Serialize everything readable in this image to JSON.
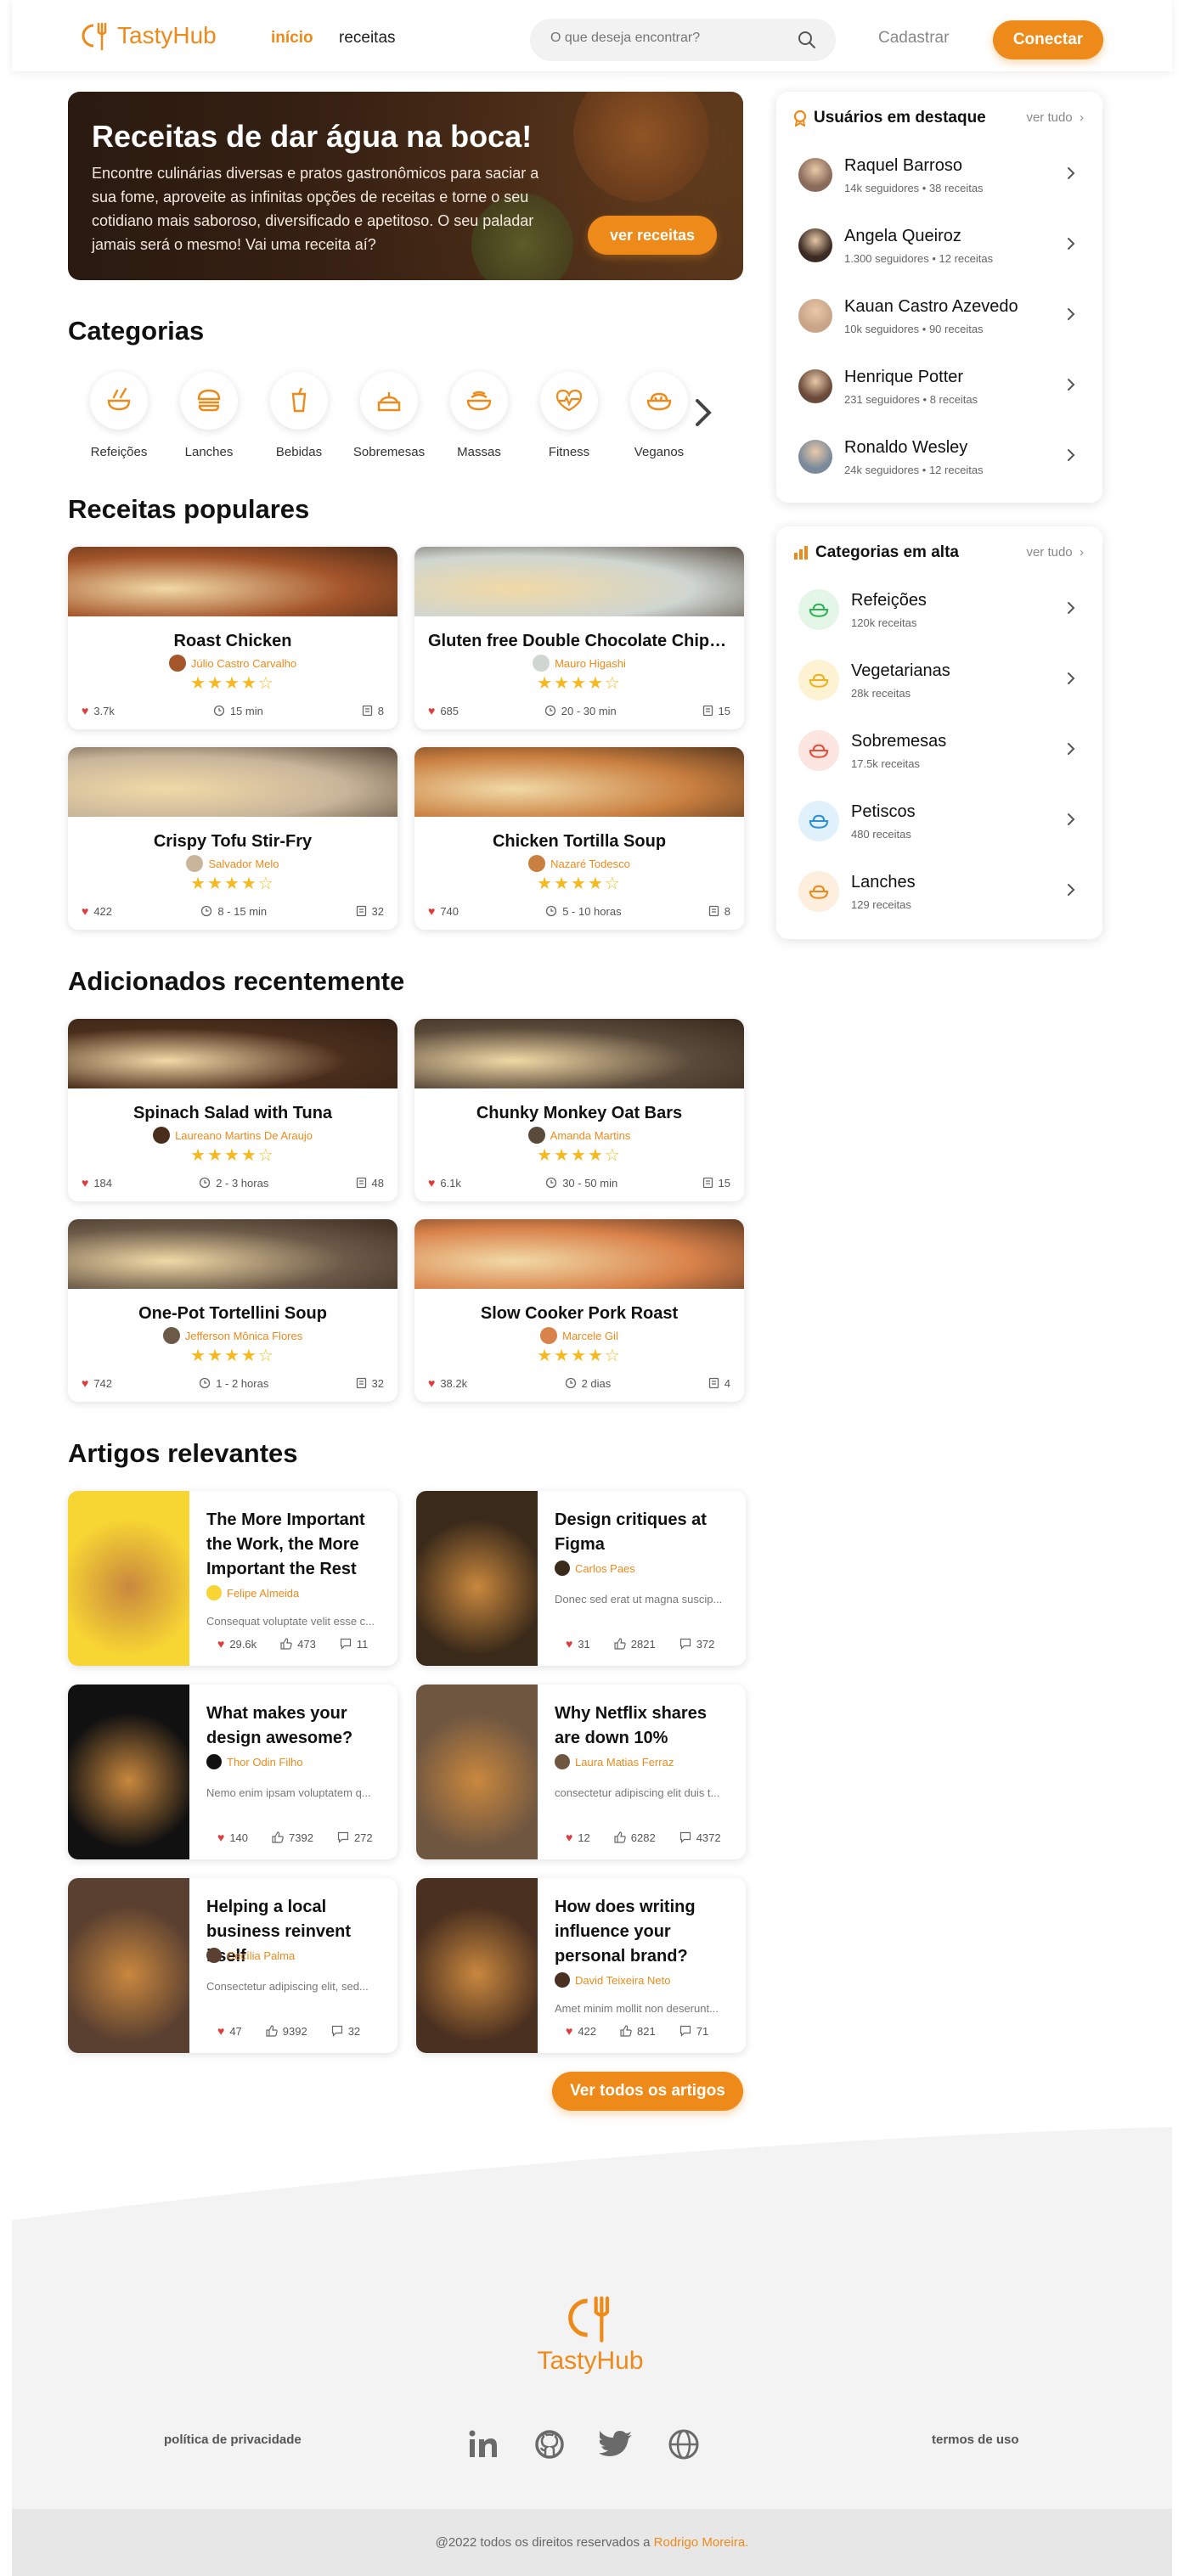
{
  "header": {
    "brand": "TastyHub",
    "nav": [
      "início",
      "receitas"
    ],
    "search_placeholder": "O que deseja encontrar?",
    "signup": "Cadastrar",
    "login": "Conectar"
  },
  "hero": {
    "title": "Receitas de dar água na boca!",
    "text": "Encontre culinárias diversas e pratos gastronômicos para saciar a sua fome, aproveite as infinitas opções de receitas e torne o seu cotidiano mais saboroso, diversificado e apetitoso. O seu paladar jamais será o mesmo! Vai uma receita aí?",
    "button": "ver receitas"
  },
  "categories": {
    "title": "Categorias",
    "items": [
      "Refeições",
      "Lanches",
      "Bebidas",
      "Sobremesas",
      "Massas",
      "Fitness",
      "Veganos"
    ]
  },
  "popular": {
    "title": "Receitas populares",
    "cards": [
      {
        "title": "Roast Chicken",
        "author": "Júlio Castro Carvalho",
        "rating": 3.5,
        "likes": "3.7k",
        "time": "15 min",
        "portions": "8",
        "img_color": "#a4552a"
      },
      {
        "title": "Gluten free Double Chocolate Chip B...",
        "author": "Mauro Higashi",
        "rating": 3.5,
        "likes": "685",
        "time": "20 - 30 min",
        "portions": "15",
        "img_color": "#cfd6d0"
      },
      {
        "title": "Crispy Tofu Stir-Fry",
        "author": "Salvador Melo",
        "rating": 3.5,
        "likes": "422",
        "time": "8 - 15 min",
        "portions": "32",
        "img_color": "#c8b59a"
      },
      {
        "title": "Chicken Tortilla Soup",
        "author": "Nazaré Todesco",
        "rating": 3.5,
        "likes": "740",
        "time": "5 - 10 horas",
        "portions": "8",
        "img_color": "#c97f3f"
      }
    ]
  },
  "recent": {
    "title": "Adicionados recentemente",
    "cards": [
      {
        "title": "Spinach Salad with Tuna",
        "author": "Laureano Martins De Araujo",
        "rating": 3.5,
        "likes": "184",
        "time": "2 - 3 horas",
        "portions": "48",
        "img_color": "#4a2e1c"
      },
      {
        "title": "Chunky Monkey Oat Bars",
        "author": "Amanda Martins",
        "rating": 3.5,
        "likes": "6.1k",
        "time": "30 - 50 min",
        "portions": "15",
        "img_color": "#5a4a3a"
      },
      {
        "title": "One-Pot Tortellini Soup",
        "author": "Jefferson Mônica Flores",
        "rating": 3.5,
        "likes": "742",
        "time": "1 - 2 horas",
        "portions": "32",
        "img_color": "#6b5a48"
      },
      {
        "title": "Slow Cooker Pork Roast",
        "author": "Marcele Gil",
        "rating": 3.5,
        "likes": "38.2k",
        "time": "2 dias",
        "portions": "4",
        "img_color": "#d9824a"
      }
    ]
  },
  "articles": {
    "title": "Artigos relevantes",
    "button": "Ver todos os artigos",
    "cards": [
      {
        "title": "The More Important the Work, the More Important the Rest",
        "author": "Felipe Almeida",
        "excerpt": "Consequat voluptate velit esse c...",
        "likes": "29.6k",
        "thumbs": "473",
        "comments": "11",
        "img_color": "#f7d533"
      },
      {
        "title": "Design critiques at Figma",
        "author": "Carlos Paes",
        "excerpt": "Donec sed erat ut magna suscip...",
        "likes": "31",
        "thumbs": "2821",
        "comments": "372",
        "img_color": "#3a2a1a"
      },
      {
        "title": "What makes your design awesome?",
        "author": "Thor Odin Filho",
        "excerpt": "Nemo enim ipsam voluptatem q...",
        "likes": "140",
        "thumbs": "7392",
        "comments": "272",
        "img_color": "#111111"
      },
      {
        "title": "Why Netflix shares are down 10%",
        "author": "Laura Matias Ferraz",
        "excerpt": "consectetur adipiscing elit duis t...",
        "likes": "12",
        "thumbs": "6282",
        "comments": "4372",
        "img_color": "#6e5640"
      },
      {
        "title": "Helping a local business reinvent itself",
        "author": "Cecília Palma",
        "excerpt": "Consectetur adipiscing elit, sed...",
        "likes": "47",
        "thumbs": "9392",
        "comments": "32",
        "img_color": "#5a4030"
      },
      {
        "title": "How does writing influence your personal brand?",
        "author": "David Teixeira Neto",
        "excerpt": "Amet minim mollit non deserunt...",
        "likes": "422",
        "thumbs": "821",
        "comments": "71",
        "img_color": "#4a3020"
      }
    ]
  },
  "featured_users": {
    "title": "Usuários em destaque",
    "more": "ver tudo",
    "users": [
      {
        "name": "Raquel Barroso",
        "followers": "14k seguidores",
        "recipes": "38 receitas",
        "color": "#8a6a5a"
      },
      {
        "name": "Angela Queiroz",
        "followers": "1.300 seguidores",
        "recipes": "12 receitas",
        "color": "#3a2a22"
      },
      {
        "name": "Kauan Castro Azevedo",
        "followers": "10k seguidores",
        "recipes": "90 receitas",
        "color": "#c9a488"
      },
      {
        "name": "Henrique Potter",
        "followers": "231 seguidores",
        "recipes": "8 receitas",
        "color": "#6a4a3a"
      },
      {
        "name": "Ronaldo Wesley",
        "followers": "24k seguidores",
        "recipes": "12 receitas",
        "color": "#7a8a9a"
      }
    ]
  },
  "trending": {
    "title": "Categorias em alta",
    "more": "ver tudo",
    "items": [
      {
        "name": "Refeições",
        "count": "120k receitas",
        "bg": "#e4f6e8",
        "fg": "#2fb352"
      },
      {
        "name": "Vegetarianas",
        "count": "28k receitas",
        "bg": "#fdf3d3",
        "fg": "#f0b020"
      },
      {
        "name": "Sobremesas",
        "count": "17.5k receitas",
        "bg": "#fde6e2",
        "fg": "#e8503a"
      },
      {
        "name": "Petiscos",
        "count": "480 receitas",
        "bg": "#e1f1fb",
        "fg": "#2d8fd6"
      },
      {
        "name": "Lanches",
        "count": "129 receitas",
        "bg": "#fdeede",
        "fg": "#ee8a1a"
      }
    ]
  },
  "footer": {
    "brand": "TastyHub",
    "privacy": "política de privacidade",
    "terms": "termos de uso",
    "copyright": "@2022 todos os direitos reservados a",
    "owner": "Rodrigo Moreira."
  },
  "colors": {
    "accent": "#ee8a1a",
    "star": "#f5b921",
    "heart": "#e03a3a"
  }
}
